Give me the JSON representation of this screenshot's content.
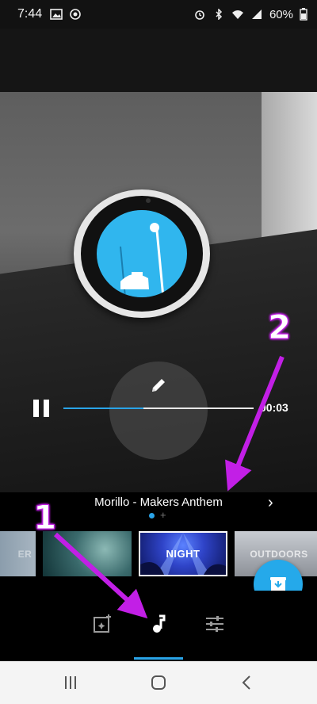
{
  "status_bar": {
    "time": "7:44",
    "battery": "60%",
    "left_icons": [
      "image-icon",
      "camera-icon"
    ],
    "right_icons": [
      "alarm-icon",
      "bluetooth-icon",
      "wifi-icon",
      "signal-icon"
    ]
  },
  "player": {
    "time": "00:03",
    "progress": 0.42
  },
  "music": {
    "title": "Morillo - Makers Anthem",
    "pages": 2,
    "current_page": 1
  },
  "filters": [
    {
      "label": "CLEAR",
      "visible_label": "ER",
      "selected": false
    },
    {
      "label": "",
      "selected": false
    },
    {
      "label": "NIGHT",
      "selected": true
    },
    {
      "label": "OUTDOORS",
      "selected": false
    }
  ],
  "toolbar": {
    "items": [
      "add-photo-icon",
      "music-note-icon",
      "adjust-icon"
    ],
    "active": 1
  },
  "annotations": {
    "label_1": "1",
    "label_2": "2",
    "arrow_color": "#c21fe6"
  },
  "colors": {
    "accent": "#2aa4e8",
    "fab": "#25a9ea"
  }
}
